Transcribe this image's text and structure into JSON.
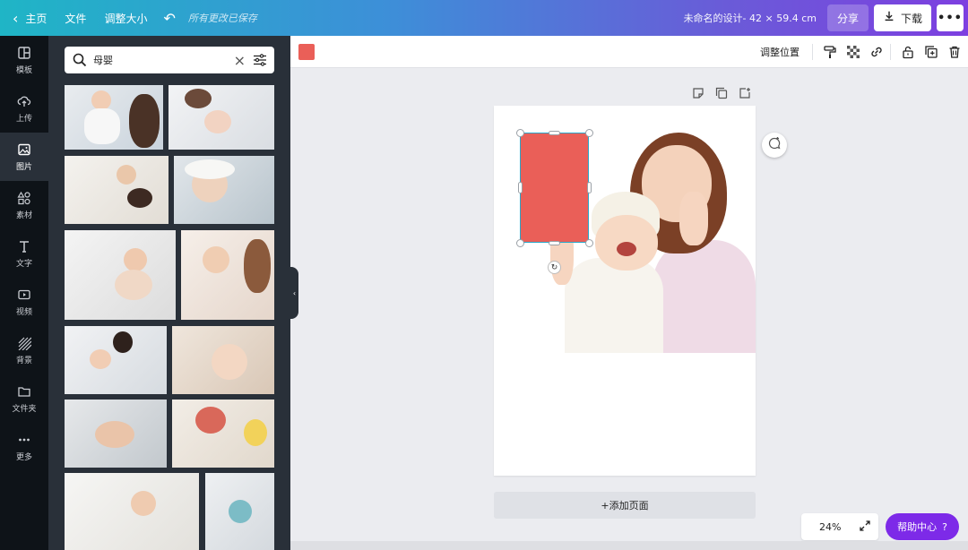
{
  "topbar": {
    "home_label": "主页",
    "file_label": "文件",
    "resize_label": "调整大小",
    "saved_text": "所有更改已保存",
    "design_title": "未命名的设计- 42 × 59.4 cm",
    "share_label": "分享",
    "download_label": "下载",
    "more_label": "•••"
  },
  "rail": {
    "items": [
      {
        "label": "模板",
        "icon": "templates-icon"
      },
      {
        "label": "上传",
        "icon": "upload-icon"
      },
      {
        "label": "图片",
        "icon": "photos-icon",
        "active": true
      },
      {
        "label": "素材",
        "icon": "elements-icon"
      },
      {
        "label": "文字",
        "icon": "text-icon"
      },
      {
        "label": "视频",
        "icon": "video-icon"
      },
      {
        "label": "背景",
        "icon": "background-icon"
      },
      {
        "label": "文件夹",
        "icon": "folder-icon"
      },
      {
        "label": "更多",
        "icon": "more-icon"
      }
    ]
  },
  "search": {
    "value": "母婴",
    "clear_glyph": "×"
  },
  "canvas_toolbar": {
    "swatch_color": "#ea5f58",
    "position_label": "调整位置"
  },
  "canvas": {
    "add_page_label": "+添加页面",
    "rect_color": "#ea5f58",
    "selection_color": "#2aa7c9"
  },
  "footer": {
    "zoom_value": "24%",
    "help_label": "帮助中心",
    "help_glyph": "?"
  },
  "colors": {
    "accent": "#7d2ae8",
    "rail_bg": "#0e1318",
    "panel_bg": "#293039"
  }
}
